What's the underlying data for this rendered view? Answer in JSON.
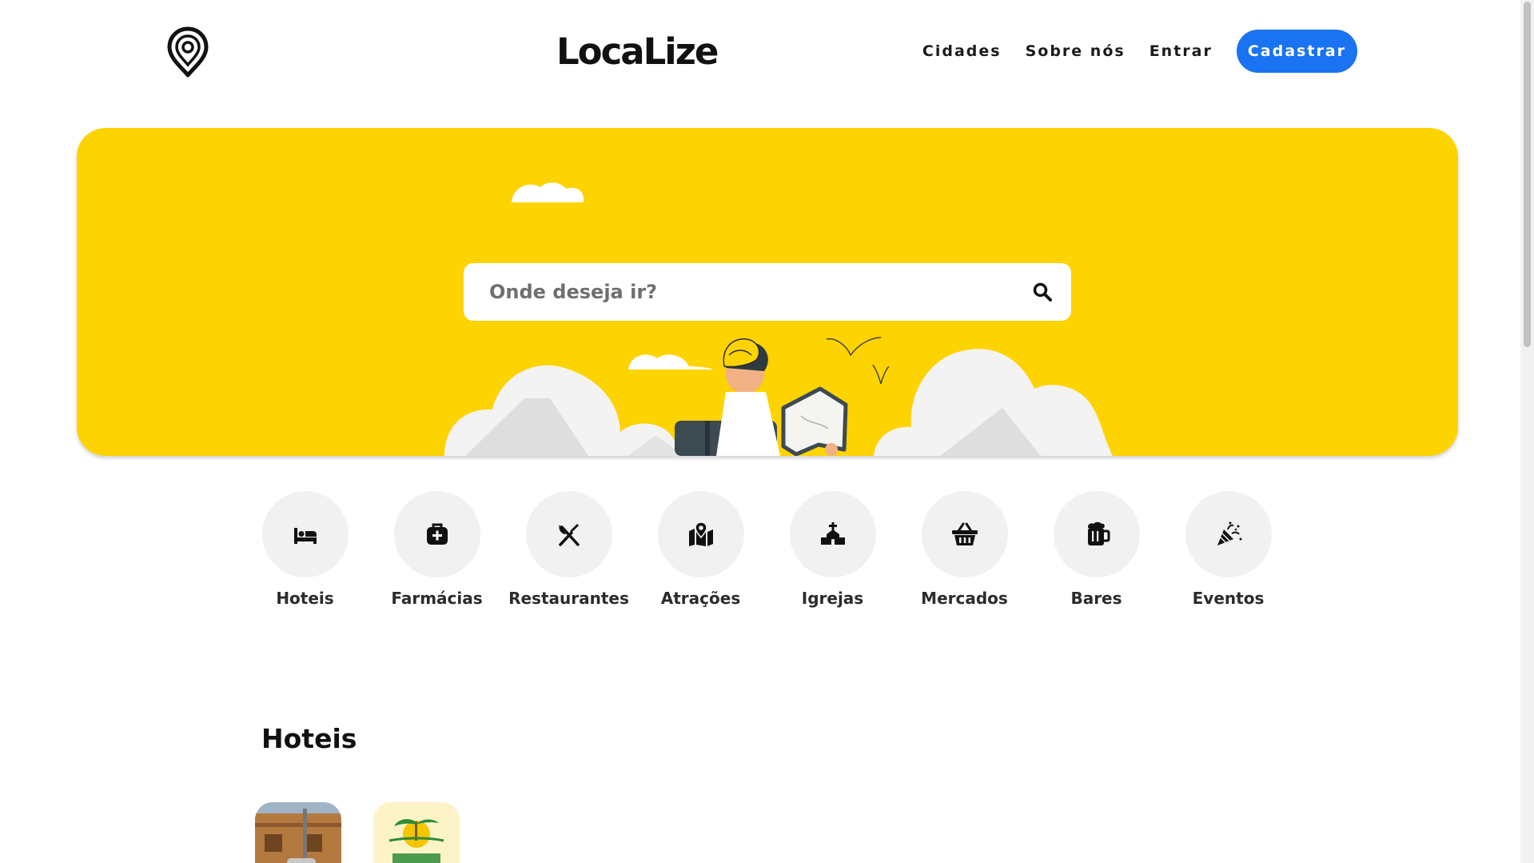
{
  "brand": {
    "name": "LocaLize"
  },
  "nav": {
    "cidades": "Cidades",
    "sobre": "Sobre nós",
    "entrar": "Entrar",
    "cadastrar": "Cadastrar"
  },
  "search": {
    "placeholder": "Onde deseja ir?",
    "icon": "search-icon"
  },
  "categories": [
    {
      "label": "Hoteis",
      "icon": "bed-icon"
    },
    {
      "label": "Farmácias",
      "icon": "medkit-icon"
    },
    {
      "label": "Restaurantes",
      "icon": "utensils-icon"
    },
    {
      "label": "Atrações",
      "icon": "map-pin-icon"
    },
    {
      "label": "Igrejas",
      "icon": "church-icon"
    },
    {
      "label": "Mercados",
      "icon": "basket-icon"
    },
    {
      "label": "Bares",
      "icon": "beer-mug-icon"
    },
    {
      "label": "Eventos",
      "icon": "party-popper-icon"
    }
  ],
  "hotels_section": {
    "title": "Hoteis"
  },
  "colors": {
    "accent": "#1a73f0",
    "hero": "#fdd300",
    "circle": "#f1f1f1"
  }
}
